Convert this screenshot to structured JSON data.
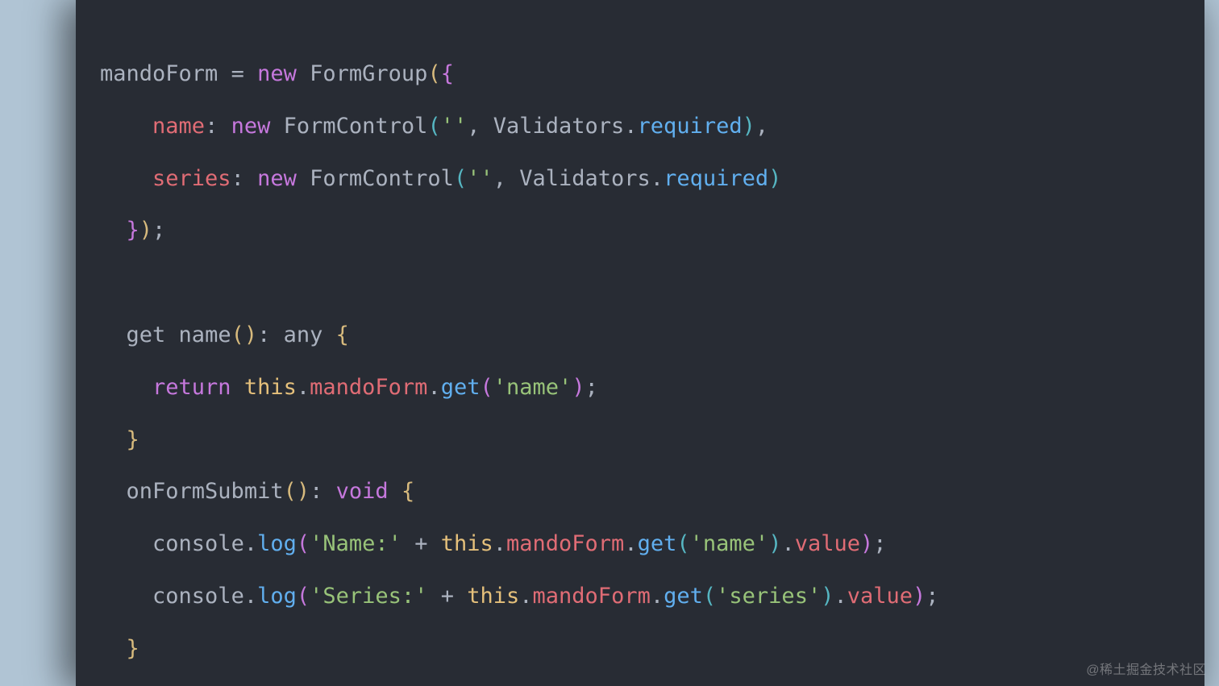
{
  "watermark": "@稀土掘金技术社区",
  "code": {
    "lines": [
      {
        "indent": 0,
        "tokens": [
          {
            "t": "mandoForm ",
            "c": "tok-default"
          },
          {
            "t": "=",
            "c": "tok-operator"
          },
          {
            "t": " ",
            "c": "tok-default"
          },
          {
            "t": "new",
            "c": "tok-keyword"
          },
          {
            "t": " FormGroup",
            "c": "tok-type"
          },
          {
            "t": "(",
            "c": "tok-paren-yellow"
          },
          {
            "t": "{",
            "c": "tok-paren-purple"
          }
        ]
      },
      {
        "indent": 2,
        "tokens": [
          {
            "t": "name",
            "c": "tok-property"
          },
          {
            "t": ": ",
            "c": "tok-punct"
          },
          {
            "t": "new",
            "c": "tok-keyword"
          },
          {
            "t": " FormControl",
            "c": "tok-type"
          },
          {
            "t": "(",
            "c": "tok-paren-blue"
          },
          {
            "t": "''",
            "c": "tok-string"
          },
          {
            "t": ", Validators.",
            "c": "tok-default"
          },
          {
            "t": "required",
            "c": "tok-method"
          },
          {
            "t": ")",
            "c": "tok-paren-blue"
          },
          {
            "t": ",",
            "c": "tok-punct"
          }
        ]
      },
      {
        "indent": 2,
        "tokens": [
          {
            "t": "series",
            "c": "tok-property"
          },
          {
            "t": ": ",
            "c": "tok-punct"
          },
          {
            "t": "new",
            "c": "tok-keyword"
          },
          {
            "t": " FormControl",
            "c": "tok-type"
          },
          {
            "t": "(",
            "c": "tok-paren-blue"
          },
          {
            "t": "''",
            "c": "tok-string"
          },
          {
            "t": ", Validators.",
            "c": "tok-default"
          },
          {
            "t": "required",
            "c": "tok-method"
          },
          {
            "t": ")",
            "c": "tok-paren-blue"
          }
        ]
      },
      {
        "indent": 1,
        "tokens": [
          {
            "t": "}",
            "c": "tok-paren-purple"
          },
          {
            "t": ")",
            "c": "tok-paren-yellow"
          },
          {
            "t": ";",
            "c": "tok-punct"
          }
        ]
      },
      {
        "indent": 0,
        "tokens": []
      },
      {
        "indent": 1,
        "tokens": [
          {
            "t": "get",
            "c": "tok-default"
          },
          {
            "t": " name",
            "c": "tok-default"
          },
          {
            "t": "(",
            "c": "tok-paren-yellow"
          },
          {
            "t": ")",
            "c": "tok-paren-yellow"
          },
          {
            "t": ": any ",
            "c": "tok-default"
          },
          {
            "t": "{",
            "c": "tok-paren-yellow"
          }
        ]
      },
      {
        "indent": 2,
        "tokens": [
          {
            "t": "return",
            "c": "tok-keyword"
          },
          {
            "t": " ",
            "c": "tok-default"
          },
          {
            "t": "this",
            "c": "tok-this"
          },
          {
            "t": ".",
            "c": "tok-punct"
          },
          {
            "t": "mandoForm",
            "c": "tok-property"
          },
          {
            "t": ".",
            "c": "tok-punct"
          },
          {
            "t": "get",
            "c": "tok-method"
          },
          {
            "t": "(",
            "c": "tok-paren-purple"
          },
          {
            "t": "'name'",
            "c": "tok-string"
          },
          {
            "t": ")",
            "c": "tok-paren-purple"
          },
          {
            "t": ";",
            "c": "tok-punct"
          }
        ]
      },
      {
        "indent": 1,
        "tokens": [
          {
            "t": "}",
            "c": "tok-paren-yellow"
          }
        ]
      },
      {
        "indent": 1,
        "tokens": [
          {
            "t": "onFormSubmit",
            "c": "tok-default"
          },
          {
            "t": "(",
            "c": "tok-paren-yellow"
          },
          {
            "t": ")",
            "c": "tok-paren-yellow"
          },
          {
            "t": ": ",
            "c": "tok-default"
          },
          {
            "t": "void",
            "c": "tok-keyword"
          },
          {
            "t": " ",
            "c": "tok-default"
          },
          {
            "t": "{",
            "c": "tok-paren-yellow"
          }
        ]
      },
      {
        "indent": 2,
        "tokens": [
          {
            "t": "console",
            "c": "tok-default"
          },
          {
            "t": ".",
            "c": "tok-punct"
          },
          {
            "t": "log",
            "c": "tok-method"
          },
          {
            "t": "(",
            "c": "tok-paren-purple"
          },
          {
            "t": "'Name:'",
            "c": "tok-string"
          },
          {
            "t": " + ",
            "c": "tok-operator"
          },
          {
            "t": "this",
            "c": "tok-this"
          },
          {
            "t": ".",
            "c": "tok-punct"
          },
          {
            "t": "mandoForm",
            "c": "tok-property"
          },
          {
            "t": ".",
            "c": "tok-punct"
          },
          {
            "t": "get",
            "c": "tok-method"
          },
          {
            "t": "(",
            "c": "tok-paren-blue"
          },
          {
            "t": "'name'",
            "c": "tok-string"
          },
          {
            "t": ")",
            "c": "tok-paren-blue"
          },
          {
            "t": ".",
            "c": "tok-punct"
          },
          {
            "t": "value",
            "c": "tok-property"
          },
          {
            "t": ")",
            "c": "tok-paren-purple"
          },
          {
            "t": ";",
            "c": "tok-punct"
          }
        ]
      },
      {
        "indent": 2,
        "tokens": [
          {
            "t": "console",
            "c": "tok-default"
          },
          {
            "t": ".",
            "c": "tok-punct"
          },
          {
            "t": "log",
            "c": "tok-method"
          },
          {
            "t": "(",
            "c": "tok-paren-purple"
          },
          {
            "t": "'Series:'",
            "c": "tok-string"
          },
          {
            "t": " + ",
            "c": "tok-operator"
          },
          {
            "t": "this",
            "c": "tok-this"
          },
          {
            "t": ".",
            "c": "tok-punct"
          },
          {
            "t": "mandoForm",
            "c": "tok-property"
          },
          {
            "t": ".",
            "c": "tok-punct"
          },
          {
            "t": "get",
            "c": "tok-method"
          },
          {
            "t": "(",
            "c": "tok-paren-blue"
          },
          {
            "t": "'series'",
            "c": "tok-string"
          },
          {
            "t": ")",
            "c": "tok-paren-blue"
          },
          {
            "t": ".",
            "c": "tok-punct"
          },
          {
            "t": "value",
            "c": "tok-property"
          },
          {
            "t": ")",
            "c": "tok-paren-purple"
          },
          {
            "t": ";",
            "c": "tok-punct"
          }
        ]
      },
      {
        "indent": 1,
        "tokens": [
          {
            "t": "}",
            "c": "tok-paren-yellow"
          }
        ]
      }
    ]
  }
}
